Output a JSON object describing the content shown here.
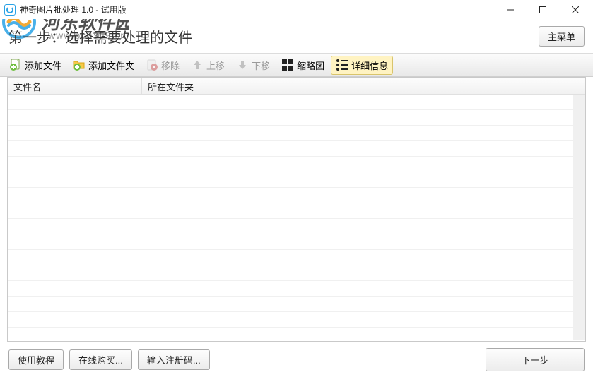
{
  "titlebar": {
    "title": "神奇图片批处理 1.0 - 试用版"
  },
  "watermark": {
    "brand": "河东软件园",
    "url": "www.pc0359.cn"
  },
  "step": {
    "title": "第一步：选择需要处理的文件",
    "main_menu": "主菜单"
  },
  "toolbar": {
    "add_file": "添加文件",
    "add_folder": "添加文件夹",
    "remove": "移除",
    "move_up": "上移",
    "move_down": "下移",
    "thumbnail": "缩略图",
    "detail": "详细信息"
  },
  "table": {
    "col_filename": "文件名",
    "col_folder": "所在文件夹",
    "rows": []
  },
  "footer": {
    "tutorial": "使用教程",
    "buy_online": "在线购买...",
    "enter_code": "输入注册码...",
    "next": "下一步"
  }
}
